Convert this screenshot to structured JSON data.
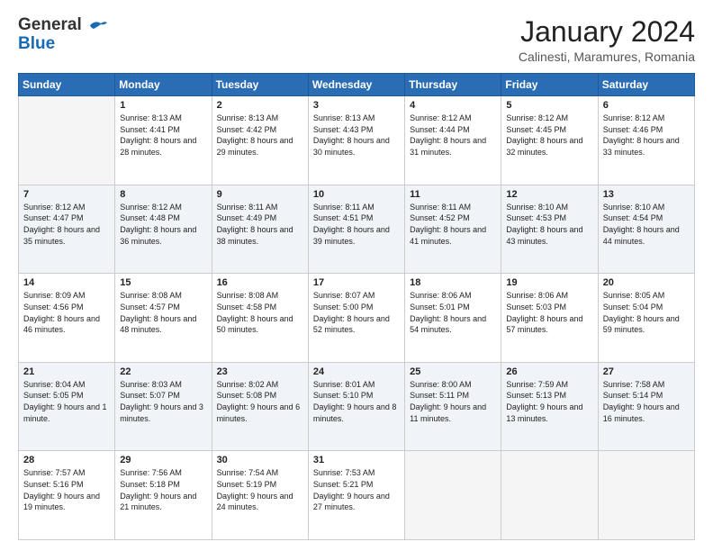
{
  "header": {
    "logo_line1": "General",
    "logo_line2": "Blue",
    "month_title": "January 2024",
    "subtitle": "Calinesti, Maramures, Romania"
  },
  "weekdays": [
    "Sunday",
    "Monday",
    "Tuesday",
    "Wednesday",
    "Thursday",
    "Friday",
    "Saturday"
  ],
  "weeks": [
    [
      {
        "day": "",
        "sunrise": "",
        "sunset": "",
        "daylight": "",
        "empty": true
      },
      {
        "day": "1",
        "sunrise": "Sunrise: 8:13 AM",
        "sunset": "Sunset: 4:41 PM",
        "daylight": "Daylight: 8 hours and 28 minutes."
      },
      {
        "day": "2",
        "sunrise": "Sunrise: 8:13 AM",
        "sunset": "Sunset: 4:42 PM",
        "daylight": "Daylight: 8 hours and 29 minutes."
      },
      {
        "day": "3",
        "sunrise": "Sunrise: 8:13 AM",
        "sunset": "Sunset: 4:43 PM",
        "daylight": "Daylight: 8 hours and 30 minutes."
      },
      {
        "day": "4",
        "sunrise": "Sunrise: 8:12 AM",
        "sunset": "Sunset: 4:44 PM",
        "daylight": "Daylight: 8 hours and 31 minutes."
      },
      {
        "day": "5",
        "sunrise": "Sunrise: 8:12 AM",
        "sunset": "Sunset: 4:45 PM",
        "daylight": "Daylight: 8 hours and 32 minutes."
      },
      {
        "day": "6",
        "sunrise": "Sunrise: 8:12 AM",
        "sunset": "Sunset: 4:46 PM",
        "daylight": "Daylight: 8 hours and 33 minutes."
      }
    ],
    [
      {
        "day": "7",
        "sunrise": "Sunrise: 8:12 AM",
        "sunset": "Sunset: 4:47 PM",
        "daylight": "Daylight: 8 hours and 35 minutes."
      },
      {
        "day": "8",
        "sunrise": "Sunrise: 8:12 AM",
        "sunset": "Sunset: 4:48 PM",
        "daylight": "Daylight: 8 hours and 36 minutes."
      },
      {
        "day": "9",
        "sunrise": "Sunrise: 8:11 AM",
        "sunset": "Sunset: 4:49 PM",
        "daylight": "Daylight: 8 hours and 38 minutes."
      },
      {
        "day": "10",
        "sunrise": "Sunrise: 8:11 AM",
        "sunset": "Sunset: 4:51 PM",
        "daylight": "Daylight: 8 hours and 39 minutes."
      },
      {
        "day": "11",
        "sunrise": "Sunrise: 8:11 AM",
        "sunset": "Sunset: 4:52 PM",
        "daylight": "Daylight: 8 hours and 41 minutes."
      },
      {
        "day": "12",
        "sunrise": "Sunrise: 8:10 AM",
        "sunset": "Sunset: 4:53 PM",
        "daylight": "Daylight: 8 hours and 43 minutes."
      },
      {
        "day": "13",
        "sunrise": "Sunrise: 8:10 AM",
        "sunset": "Sunset: 4:54 PM",
        "daylight": "Daylight: 8 hours and 44 minutes."
      }
    ],
    [
      {
        "day": "14",
        "sunrise": "Sunrise: 8:09 AM",
        "sunset": "Sunset: 4:56 PM",
        "daylight": "Daylight: 8 hours and 46 minutes."
      },
      {
        "day": "15",
        "sunrise": "Sunrise: 8:08 AM",
        "sunset": "Sunset: 4:57 PM",
        "daylight": "Daylight: 8 hours and 48 minutes."
      },
      {
        "day": "16",
        "sunrise": "Sunrise: 8:08 AM",
        "sunset": "Sunset: 4:58 PM",
        "daylight": "Daylight: 8 hours and 50 minutes."
      },
      {
        "day": "17",
        "sunrise": "Sunrise: 8:07 AM",
        "sunset": "Sunset: 5:00 PM",
        "daylight": "Daylight: 8 hours and 52 minutes."
      },
      {
        "day": "18",
        "sunrise": "Sunrise: 8:06 AM",
        "sunset": "Sunset: 5:01 PM",
        "daylight": "Daylight: 8 hours and 54 minutes."
      },
      {
        "day": "19",
        "sunrise": "Sunrise: 8:06 AM",
        "sunset": "Sunset: 5:03 PM",
        "daylight": "Daylight: 8 hours and 57 minutes."
      },
      {
        "day": "20",
        "sunrise": "Sunrise: 8:05 AM",
        "sunset": "Sunset: 5:04 PM",
        "daylight": "Daylight: 8 hours and 59 minutes."
      }
    ],
    [
      {
        "day": "21",
        "sunrise": "Sunrise: 8:04 AM",
        "sunset": "Sunset: 5:05 PM",
        "daylight": "Daylight: 9 hours and 1 minute."
      },
      {
        "day": "22",
        "sunrise": "Sunrise: 8:03 AM",
        "sunset": "Sunset: 5:07 PM",
        "daylight": "Daylight: 9 hours and 3 minutes."
      },
      {
        "day": "23",
        "sunrise": "Sunrise: 8:02 AM",
        "sunset": "Sunset: 5:08 PM",
        "daylight": "Daylight: 9 hours and 6 minutes."
      },
      {
        "day": "24",
        "sunrise": "Sunrise: 8:01 AM",
        "sunset": "Sunset: 5:10 PM",
        "daylight": "Daylight: 9 hours and 8 minutes."
      },
      {
        "day": "25",
        "sunrise": "Sunrise: 8:00 AM",
        "sunset": "Sunset: 5:11 PM",
        "daylight": "Daylight: 9 hours and 11 minutes."
      },
      {
        "day": "26",
        "sunrise": "Sunrise: 7:59 AM",
        "sunset": "Sunset: 5:13 PM",
        "daylight": "Daylight: 9 hours and 13 minutes."
      },
      {
        "day": "27",
        "sunrise": "Sunrise: 7:58 AM",
        "sunset": "Sunset: 5:14 PM",
        "daylight": "Daylight: 9 hours and 16 minutes."
      }
    ],
    [
      {
        "day": "28",
        "sunrise": "Sunrise: 7:57 AM",
        "sunset": "Sunset: 5:16 PM",
        "daylight": "Daylight: 9 hours and 19 minutes."
      },
      {
        "day": "29",
        "sunrise": "Sunrise: 7:56 AM",
        "sunset": "Sunset: 5:18 PM",
        "daylight": "Daylight: 9 hours and 21 minutes."
      },
      {
        "day": "30",
        "sunrise": "Sunrise: 7:54 AM",
        "sunset": "Sunset: 5:19 PM",
        "daylight": "Daylight: 9 hours and 24 minutes."
      },
      {
        "day": "31",
        "sunrise": "Sunrise: 7:53 AM",
        "sunset": "Sunset: 5:21 PM",
        "daylight": "Daylight: 9 hours and 27 minutes."
      },
      {
        "day": "",
        "sunrise": "",
        "sunset": "",
        "daylight": "",
        "empty": true
      },
      {
        "day": "",
        "sunrise": "",
        "sunset": "",
        "daylight": "",
        "empty": true
      },
      {
        "day": "",
        "sunrise": "",
        "sunset": "",
        "daylight": "",
        "empty": true
      }
    ]
  ]
}
